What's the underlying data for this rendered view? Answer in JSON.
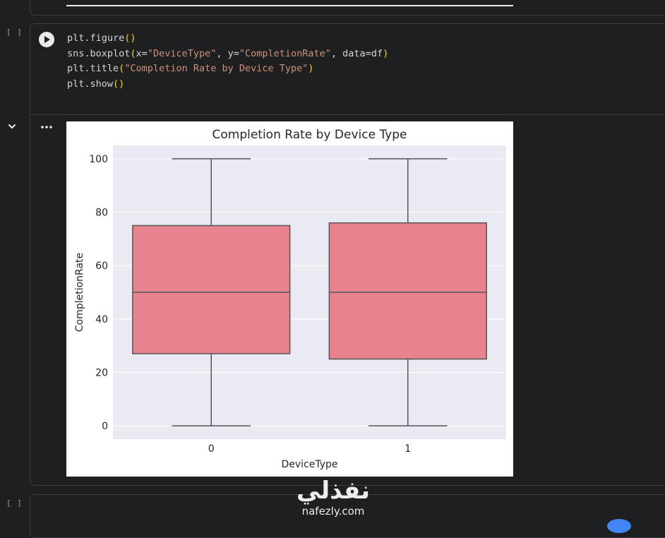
{
  "cells": {
    "code_cell": {
      "bracket": "[ ]",
      "lines": [
        {
          "parts": [
            {
              "t": "plt.figure",
              "c": "plain"
            },
            {
              "t": "()",
              "c": "paren"
            }
          ]
        },
        {
          "parts": [
            {
              "t": "sns.boxplot",
              "c": "plain"
            },
            {
              "t": "(",
              "c": "paren"
            },
            {
              "t": "x=",
              "c": "plain"
            },
            {
              "t": "\"DeviceType\"",
              "c": "str"
            },
            {
              "t": ", y=",
              "c": "plain"
            },
            {
              "t": "\"CompletionRate\"",
              "c": "str"
            },
            {
              "t": ", data=df",
              "c": "plain"
            },
            {
              "t": ")",
              "c": "paren"
            }
          ]
        },
        {
          "parts": [
            {
              "t": "plt.title",
              "c": "plain"
            },
            {
              "t": "(",
              "c": "paren"
            },
            {
              "t": "\"Completion Rate by Device Type\"",
              "c": "str"
            },
            {
              "t": ")",
              "c": "paren"
            }
          ]
        },
        {
          "parts": [
            {
              "t": "plt.show",
              "c": "plain"
            },
            {
              "t": "()",
              "c": "paren"
            }
          ]
        }
      ]
    },
    "empty_cell": {
      "bracket": "[ ]"
    }
  },
  "icons": {
    "run": "play-icon",
    "collapse": "chevron-down-icon",
    "more": "more-horizontal-icon"
  },
  "watermark": {
    "arabic": "نفذلي",
    "latin": "nafezly.com"
  },
  "colors": {
    "box_fill": "#e8828f",
    "box_edge": "#555555",
    "plot_bg": "#eaeaf2",
    "grid": "#ffffff",
    "string": "#ce9178",
    "paren": "#ffd700"
  },
  "chart_data": {
    "type": "box",
    "title": "Completion Rate by Device Type",
    "xlabel": "DeviceType",
    "ylabel": "CompletionRate",
    "categories": [
      "0",
      "1"
    ],
    "yticks": [
      0,
      20,
      40,
      60,
      80,
      100
    ],
    "ylim": [
      -5,
      105
    ],
    "grid": true,
    "boxes": [
      {
        "category": "0",
        "min": 0,
        "q1": 27,
        "median": 50,
        "q3": 75,
        "max": 100
      },
      {
        "category": "1",
        "min": 0,
        "q1": 25,
        "median": 50,
        "q3": 76,
        "max": 100
      }
    ]
  }
}
